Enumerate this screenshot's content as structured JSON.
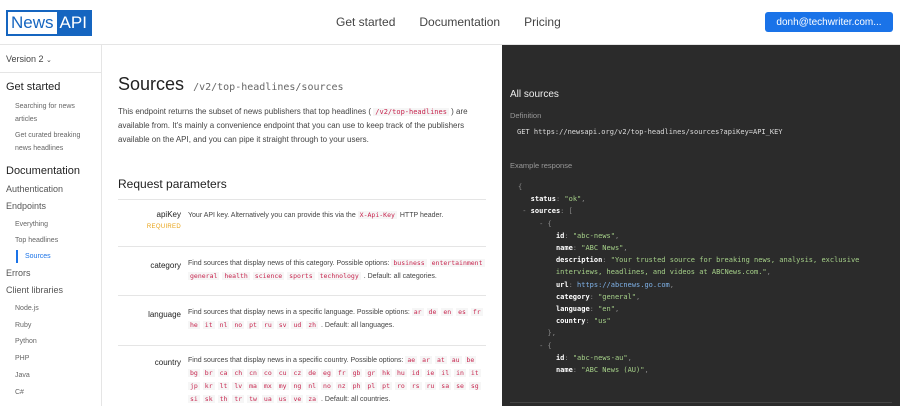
{
  "topbar": {
    "logo_news": "News",
    "logo_api": "API",
    "nav": [
      "Get started",
      "Documentation",
      "Pricing"
    ],
    "user": "donh@techwriter.com..."
  },
  "sidebar": {
    "version": "Version 2",
    "get_started": "Get started",
    "gs_items": [
      "Searching for news articles",
      "Get curated breaking news headlines"
    ],
    "documentation": "Documentation",
    "authentication": "Authentication",
    "endpoints": "Endpoints",
    "endpoint_items": [
      "Everything",
      "Top headlines",
      "Sources"
    ],
    "errors": "Errors",
    "client_libraries": "Client libraries",
    "libs": [
      "Node.js",
      "Ruby",
      "Python",
      "PHP",
      "Java",
      "C#"
    ]
  },
  "main": {
    "title": "Sources",
    "path": "/v2/top-headlines/sources",
    "desc_1": "This endpoint returns the subset of news publishers that top headlines (",
    "desc_code": "/v2/top-headlines",
    "desc_2": ") are available from. It's mainly a convenience endpoint that you can use to keep track of the publishers available on the API, and you can pipe it straight through to your users.",
    "req_title": "Request parameters",
    "params": {
      "apikey": {
        "name": "apiKey",
        "required": "REQUIRED",
        "desc_1": "Your API key. Alternatively you can provide this via the",
        "code": "X-Api-Key",
        "desc_2": "HTTP header."
      },
      "category": {
        "name": "category",
        "desc_1": "Find sources that display news of this category. Possible options:",
        "options": [
          "business",
          "entertainment",
          "general",
          "health",
          "science",
          "sports",
          "technology"
        ],
        "desc_2": ". Default: all categories."
      },
      "language": {
        "name": "language",
        "desc_1": "Find sources that display news in a specific language. Possible options:",
        "options": [
          "ar",
          "de",
          "en",
          "es",
          "fr",
          "he",
          "it",
          "nl",
          "no",
          "pt",
          "ru",
          "sv",
          "ud",
          "zh"
        ],
        "desc_2": ". Default: all languages."
      },
      "country": {
        "name": "country",
        "desc_1": "Find sources that display news in a specific country. Possible options:",
        "options": [
          "ae",
          "ar",
          "at",
          "au",
          "be",
          "bg",
          "br",
          "ca",
          "ch",
          "cn",
          "co",
          "cu",
          "cz",
          "de",
          "eg",
          "fr",
          "gb",
          "gr",
          "hk",
          "hu",
          "id",
          "ie",
          "il",
          "in",
          "it",
          "jp",
          "kr",
          "lt",
          "lv",
          "ma",
          "mx",
          "my",
          "ng",
          "nl",
          "no",
          "nz",
          "ph",
          "pl",
          "pt",
          "ro",
          "rs",
          "ru",
          "sa",
          "se",
          "sg",
          "si",
          "sk",
          "th",
          "tr",
          "tw",
          "ua",
          "us",
          "ve",
          "za"
        ],
        "desc_2": ". Default: all countries."
      }
    }
  },
  "panel": {
    "title": "All sources",
    "definition_label": "Definition",
    "definition": "GET https://newsapi.org/v2/top-headlines/sources?apiKey=API_KEY",
    "example_label": "Example response"
  },
  "colors": {
    "brand": "#1565c0",
    "button": "#1a73e8",
    "panel_bg": "#2b2b2b",
    "required": "#e8a317",
    "code": "#c7254e"
  }
}
